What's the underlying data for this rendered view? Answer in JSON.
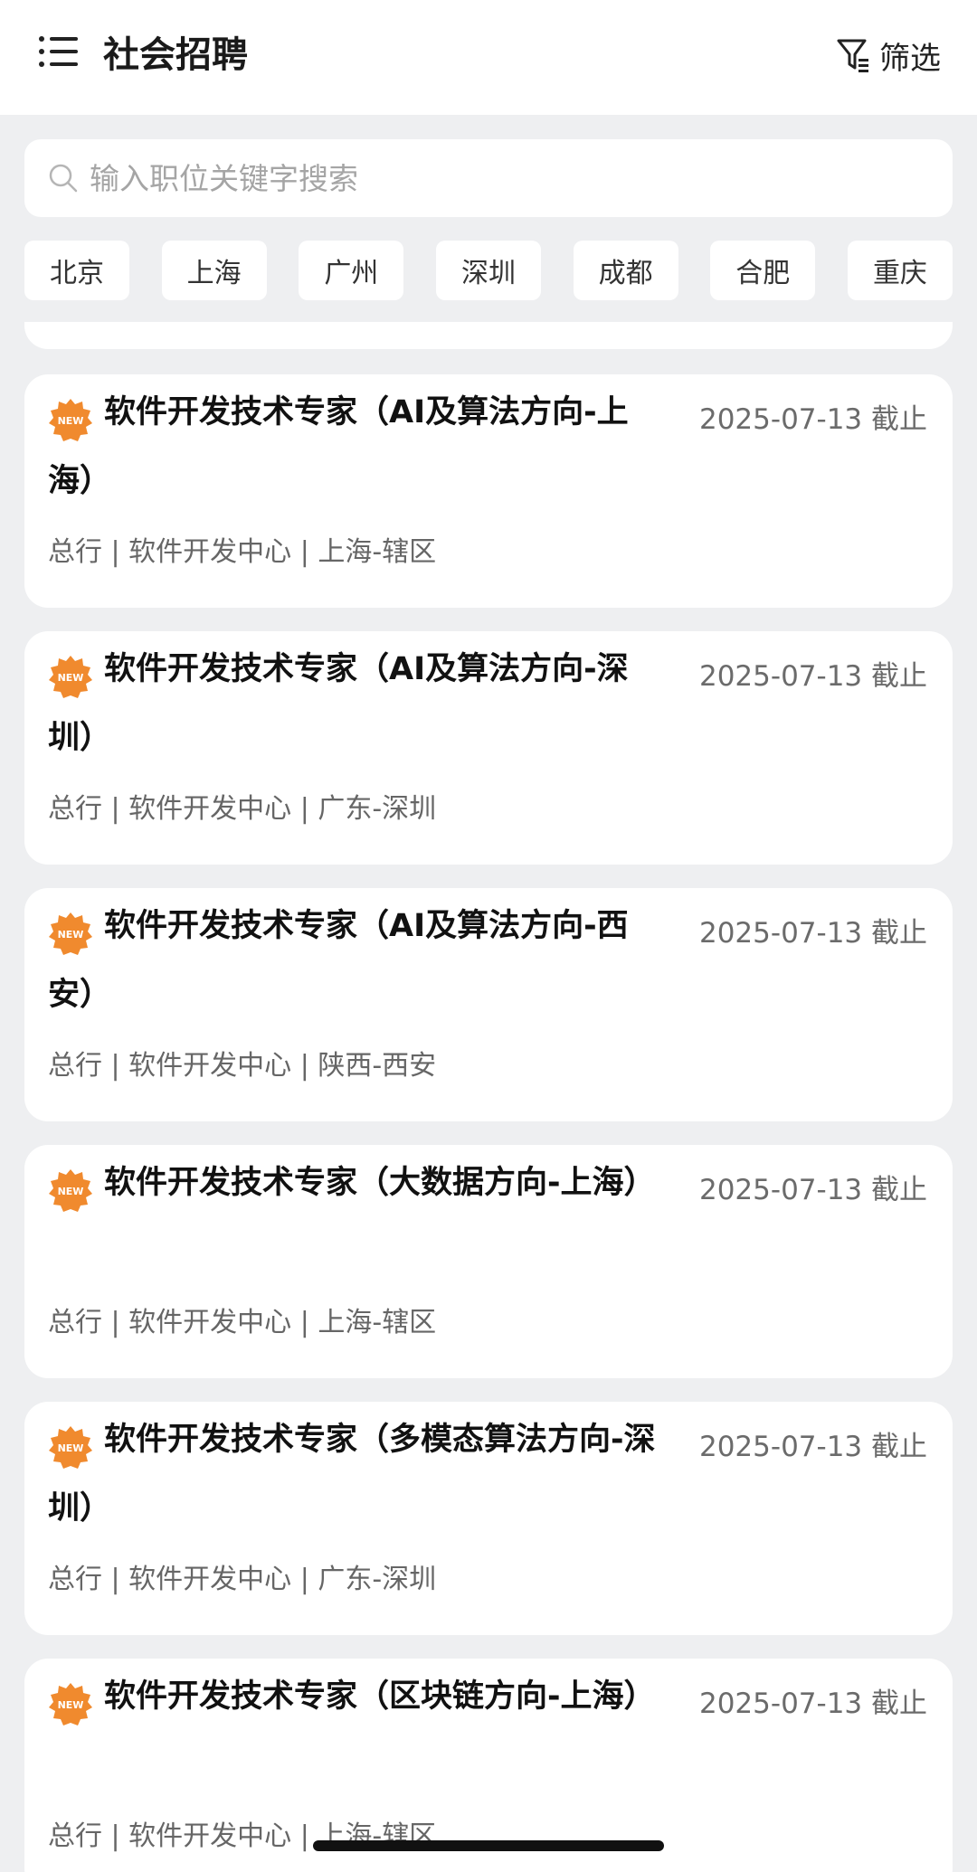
{
  "header": {
    "title": "社会招聘",
    "filter_label": "筛选"
  },
  "search": {
    "placeholder": "输入职位关键字搜索"
  },
  "cities": [
    "北京",
    "上海",
    "广州",
    "深圳",
    "成都",
    "合肥",
    "重庆"
  ],
  "jobs": [
    {
      "title": "软件开发技术专家（AI及算法方向-上海）",
      "deadline": "2025-07-13 截止",
      "meta": "总行 | 软件开发中心 | 上海-辖区"
    },
    {
      "title": "软件开发技术专家（AI及算法方向-深圳）",
      "deadline": "2025-07-13 截止",
      "meta": "总行 | 软件开发中心 | 广东-深圳"
    },
    {
      "title": "软件开发技术专家（AI及算法方向-西安）",
      "deadline": "2025-07-13 截止",
      "meta": "总行 | 软件开发中心 | 陕西-西安"
    },
    {
      "title": "软件开发技术专家（大数据方向-上海）",
      "deadline": "2025-07-13 截止",
      "meta": "总行 | 软件开发中心 | 上海-辖区"
    },
    {
      "title": "软件开发技术专家（多模态算法方向-深圳）",
      "deadline": "2025-07-13 截止",
      "meta": "总行 | 软件开发中心 | 广东-深圳"
    },
    {
      "title": "软件开发技术专家（区块链方向-上海）",
      "deadline": "2025-07-13 截止",
      "meta": "总行 | 软件开发中心 | 上海-辖区"
    }
  ],
  "badge": {
    "text": "NEW",
    "color": "#f08a2e"
  },
  "icons": {
    "menu": "list-menu-icon",
    "filter": "filter-funnel-icon",
    "search": "search-icon",
    "badge": "new-badge-icon"
  }
}
